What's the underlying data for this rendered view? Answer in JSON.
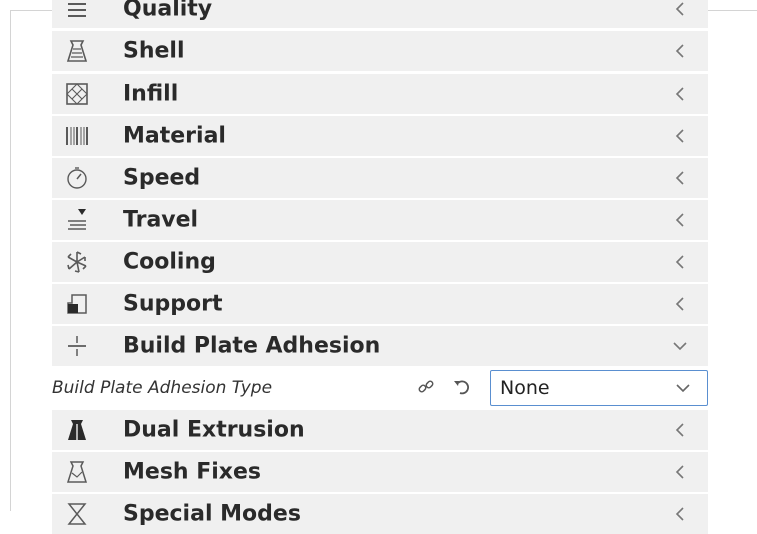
{
  "categories": [
    {
      "label": "Quality",
      "icon": "quality-icon"
    },
    {
      "label": "Shell",
      "icon": "shell-icon"
    },
    {
      "label": "Infill",
      "icon": "infill-icon"
    },
    {
      "label": "Material",
      "icon": "material-icon"
    },
    {
      "label": "Speed",
      "icon": "speed-icon"
    },
    {
      "label": "Travel",
      "icon": "travel-icon"
    },
    {
      "label": "Cooling",
      "icon": "cooling-icon"
    },
    {
      "label": "Support",
      "icon": "support-icon"
    },
    {
      "label": "Build Plate Adhesion",
      "icon": "adhesion-icon",
      "expanded": true
    },
    {
      "label": "Dual Extrusion",
      "icon": "dual-extrusion-icon"
    },
    {
      "label": "Mesh Fixes",
      "icon": "mesh-fixes-icon"
    },
    {
      "label": "Special Modes",
      "icon": "special-modes-icon"
    }
  ],
  "adhesion_setting": {
    "label": "Build Plate Adhesion Type",
    "value": "None",
    "link_icon": "link-icon",
    "reset_icon": "reset-icon"
  },
  "colors": {
    "row_background": "#f0f0f0",
    "select_border": "#5a8fd0",
    "text": "#2a2a2a",
    "icon": "#5a5a5a"
  }
}
